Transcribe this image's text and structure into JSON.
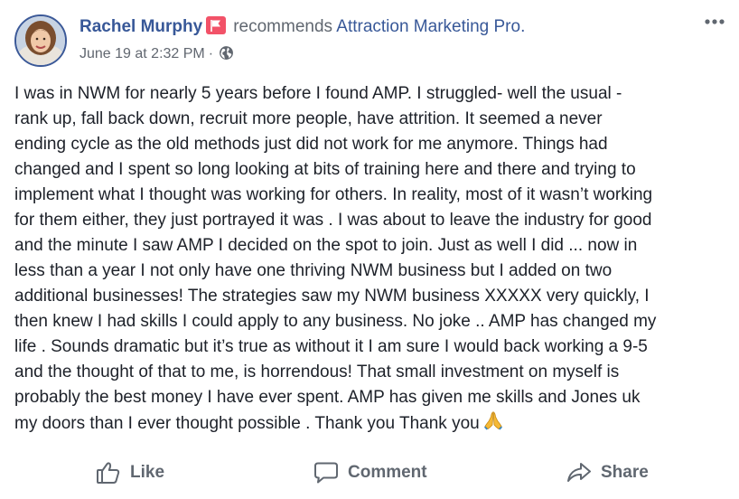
{
  "post": {
    "author": "Rachel Murphy",
    "verb": "recommends",
    "page": "Attraction Marketing Pro.",
    "timestamp": "June 19 at 2:32 PM",
    "separator": "·",
    "privacy_icon": "globe-icon",
    "badge_icon": "recommend-flag-icon",
    "more_icon": "more-options-icon",
    "body_lines": [
      "I was in NWM for nearly 5 years before I found AMP. I struggled- well the usual -",
      "rank up, fall back down, recruit more people, have attrition. It seemed a never",
      "ending cycle as the old methods just did not work for me anymore. Things had",
      "changed and I spent so long looking at bits of training here and there and trying to",
      "implement what I thought was working for others. In reality, most of it wasn’t working",
      "for them either, they just portrayed it was . I was about to leave the industry for good",
      "and the minute I saw AMP I decided on the spot to join. Just as well I did ... now in",
      "less than a year I not only have one thriving NWM business but I added on two",
      "additional businesses! The strategies saw my NWM business XXXXX very quickly, I",
      "then knew I had skills I could apply to any business. No joke .. AMP has changed my",
      "life . Sounds dramatic but it’s true as without it I am sure I would back working a 9-5",
      "and the thought of that to me, is horrendous! That small investment on myself is",
      "probably the best money I have ever spent. AMP has given me skills and Jones uk",
      "my doors than I ever thought possible . Thank you Thank you"
    ],
    "closing_emoji": "🙏"
  },
  "actions": {
    "like": "Like",
    "comment": "Comment",
    "share": "Share"
  },
  "colors": {
    "link": "#385898",
    "badge": "#f25268",
    "muted": "#606770",
    "text": "#1d2129"
  }
}
